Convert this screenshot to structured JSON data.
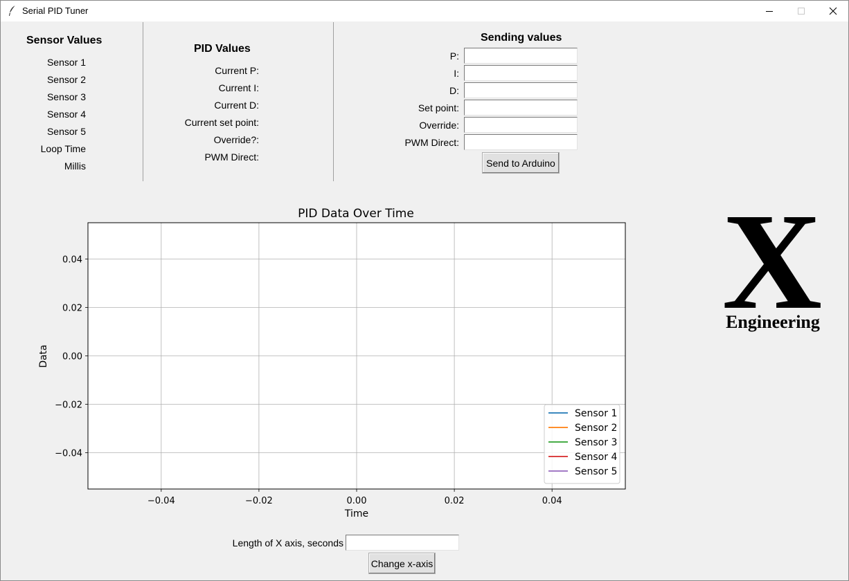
{
  "window": {
    "title": "Serial PID Tuner"
  },
  "sensor_panel": {
    "heading": "Sensor Values",
    "items": [
      "Sensor 1",
      "Sensor 2",
      "Sensor 3",
      "Sensor 4",
      "Sensor 5",
      "Loop Time",
      "Millis"
    ]
  },
  "pid_panel": {
    "heading": "PID Values",
    "items": [
      "Current P:",
      "Current I:",
      "Current D:",
      "Current set point:",
      "Override?:",
      "PWM Direct:"
    ]
  },
  "send_panel": {
    "heading": "Sending values",
    "fields": [
      {
        "label": "P:",
        "value": ""
      },
      {
        "label": "I:",
        "value": ""
      },
      {
        "label": "D:",
        "value": ""
      },
      {
        "label": "Set point:",
        "value": ""
      },
      {
        "label": "Override:",
        "value": ""
      },
      {
        "label": "PWM Direct:",
        "value": ""
      }
    ],
    "send_button": "Send to Arduino"
  },
  "xaxis_control": {
    "label": "Length of X axis, seconds",
    "value": "",
    "button": "Change x-axis"
  },
  "logo": {
    "letter": "X",
    "text": "Engineering"
  },
  "chart_data": {
    "type": "line",
    "title": "PID Data Over Time",
    "xlabel": "Time",
    "ylabel": "Data",
    "xlim": [
      -0.055,
      0.055
    ],
    "ylim": [
      -0.055,
      0.055
    ],
    "xticks": [
      -0.04,
      -0.02,
      0.0,
      0.02,
      0.04
    ],
    "yticks": [
      -0.04,
      -0.02,
      0.0,
      0.02,
      0.04
    ],
    "xtick_labels": [
      "−0.04",
      "−0.02",
      "0.00",
      "0.02",
      "0.04"
    ],
    "ytick_labels": [
      "−0.04",
      "−0.02",
      "0.00",
      "0.02",
      "0.04"
    ],
    "grid": true,
    "legend_position": "lower-right",
    "series": [
      {
        "name": "Sensor 1",
        "color": "#1f77b4",
        "x": [],
        "y": []
      },
      {
        "name": "Sensor 2",
        "color": "#ff7f0e",
        "x": [],
        "y": []
      },
      {
        "name": "Sensor 3",
        "color": "#2ca02c",
        "x": [],
        "y": []
      },
      {
        "name": "Sensor 4",
        "color": "#d62728",
        "x": [],
        "y": []
      },
      {
        "name": "Sensor 5",
        "color": "#9467bd",
        "x": [],
        "y": []
      }
    ]
  }
}
